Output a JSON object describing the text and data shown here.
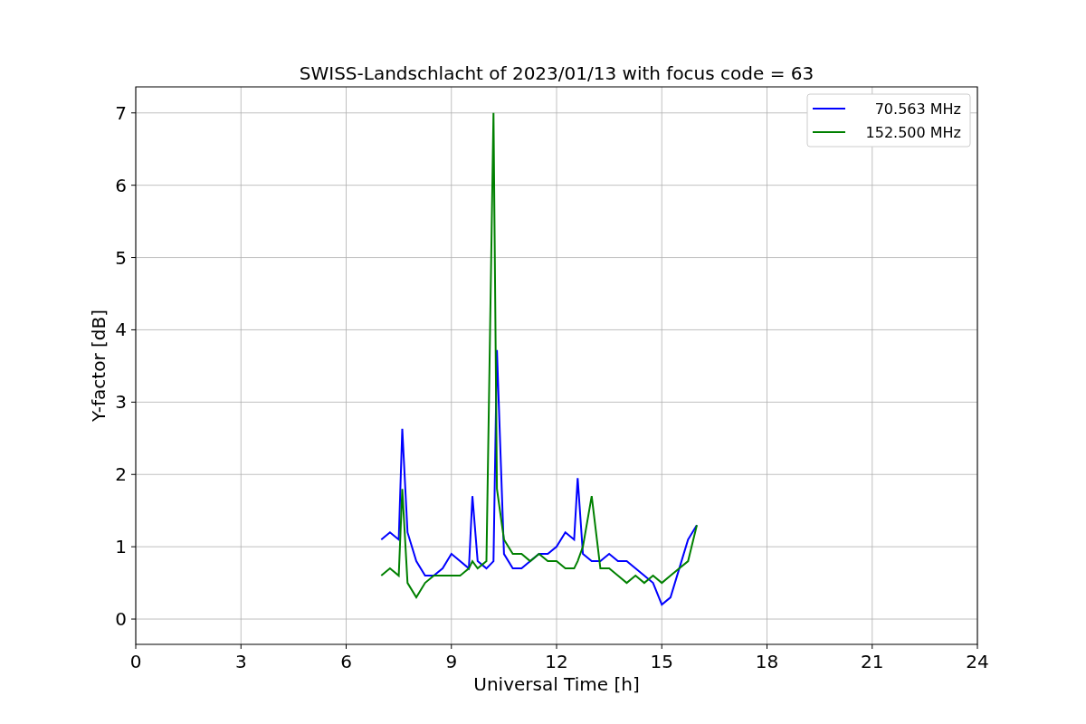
{
  "chart_data": {
    "type": "line",
    "title": "SWISS-Landschlacht of 2023/01/13 with focus code = 63",
    "xlabel": "Universal Time [h]",
    "ylabel": "Y-factor [dB]",
    "x": [
      7.0,
      7.25,
      7.5,
      7.6,
      7.75,
      8.0,
      8.25,
      8.5,
      8.75,
      9.0,
      9.25,
      9.5,
      9.6,
      9.75,
      10.0,
      10.2,
      10.3,
      10.5,
      10.75,
      11.0,
      11.25,
      11.5,
      11.75,
      12.0,
      12.25,
      12.5,
      12.6,
      12.75,
      13.0,
      13.25,
      13.5,
      13.75,
      14.0,
      14.25,
      14.5,
      14.75,
      15.0,
      15.25,
      15.5,
      15.75,
      16.0
    ],
    "series": [
      {
        "name": "70.563 MHz",
        "color": "#0000ff",
        "values": [
          1.1,
          1.2,
          1.1,
          2.63,
          1.2,
          0.8,
          0.6,
          0.6,
          0.7,
          0.9,
          0.8,
          0.7,
          1.7,
          0.8,
          0.7,
          0.8,
          3.72,
          0.9,
          0.7,
          0.7,
          0.8,
          0.9,
          0.9,
          1.0,
          1.2,
          1.1,
          1.95,
          0.9,
          0.8,
          0.8,
          0.9,
          0.8,
          0.8,
          0.7,
          0.6,
          0.5,
          0.2,
          0.3,
          0.7,
          1.1,
          1.3
        ]
      },
      {
        "name": "152.500 MHz",
        "color": "#008000",
        "values": [
          0.6,
          0.7,
          0.6,
          1.8,
          0.5,
          0.3,
          0.5,
          0.6,
          0.6,
          0.6,
          0.6,
          0.7,
          0.8,
          0.7,
          0.8,
          7.0,
          1.8,
          1.1,
          0.9,
          0.9,
          0.8,
          0.9,
          0.8,
          0.8,
          0.7,
          0.7,
          0.8,
          1.0,
          1.7,
          0.7,
          0.7,
          0.6,
          0.5,
          0.6,
          0.5,
          0.6,
          0.5,
          0.6,
          0.7,
          0.8,
          1.3
        ]
      }
    ],
    "xlim": [
      0,
      24
    ],
    "ylim": [
      -0.35,
      7.36
    ],
    "xticks": [
      0,
      3,
      6,
      9,
      12,
      15,
      18,
      21,
      24
    ],
    "yticks": [
      0,
      1,
      2,
      3,
      4,
      5,
      6,
      7
    ],
    "grid": true,
    "legend": true
  }
}
